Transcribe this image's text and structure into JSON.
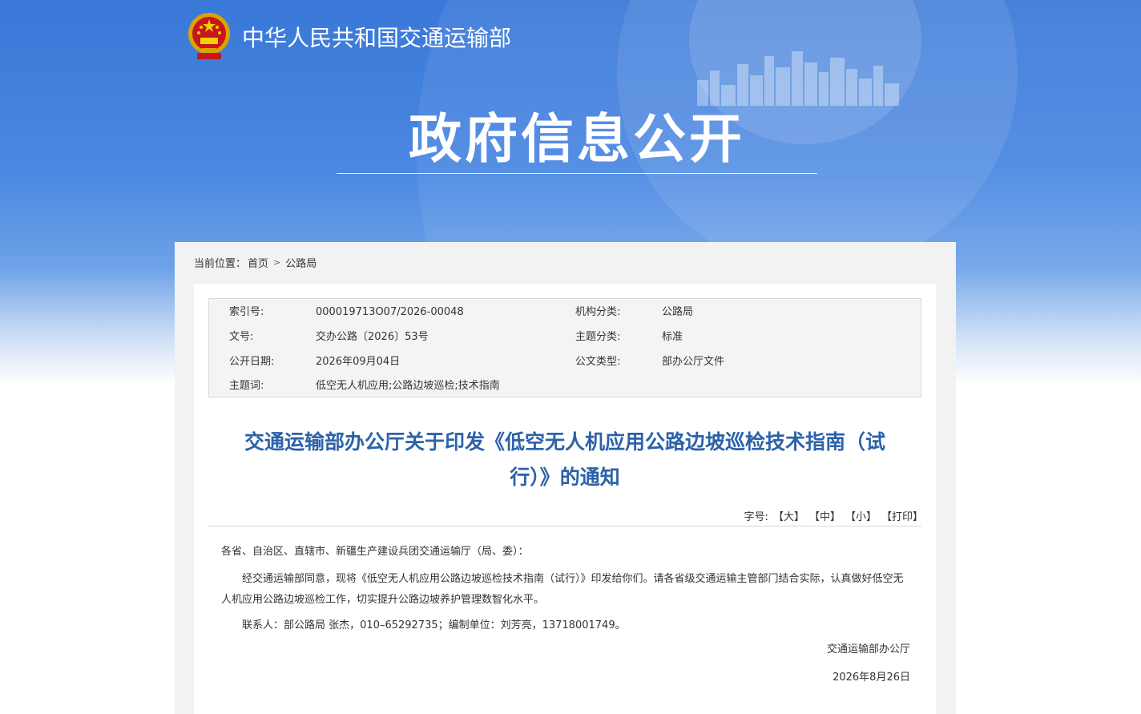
{
  "header": {
    "ministry_name": "中华人民共和国交通运输部",
    "section_title": "政府信息公开"
  },
  "breadcrumb": {
    "label": "当前位置：",
    "items": [
      "首页",
      "公路局"
    ],
    "separator": ">"
  },
  "meta": {
    "index_label": "索引号:",
    "index_value": "000019713O07/2026-00048",
    "org_label": "机构分类:",
    "org_value": "公路局",
    "doc_no_label": "文号:",
    "doc_no_value": "交办公路〔2026〕53号",
    "topic_label": "主题分类:",
    "topic_value": "标准",
    "date_label": "公开日期:",
    "date_value": "2026年09月04日",
    "type_label": "公文类型:",
    "type_value": "部办公厅文件",
    "keywords_label": "主题词:",
    "keywords_value": "低空无人机应用;公路边坡巡检;技术指南"
  },
  "document": {
    "title_line1": "交通运输部办公厅关于印发《低空无人机应用公路边坡巡检技术指南（试",
    "title_line2": "行）》的通知",
    "font_size_label": "字号:",
    "font_large": "【大】",
    "font_medium": "【中】",
    "font_small": "【小】",
    "print": "【打印】",
    "salutation": "各省、自治区、直辖市、新疆生产建设兵团交通运输厅（局、委）：",
    "paragraph1": "经交通运输部同意，现将《低空无人机应用公路边坡巡检技术指南（试行）》印发给你们。请各省级交通运输主管部门结合实际，认真做好低空无人机应用公路边坡巡检工作，切实提升公路边坡养护管理数智化水平。",
    "contact": "联系人：部公路局 张杰，010–65292735；编制单位：刘芳亮，13718001749。",
    "signature": "交通运输部办公厅",
    "sign_date": "2026年8月26日"
  },
  "colors": {
    "hero_blue": "#3a78d8",
    "title_blue": "#2c62a9"
  }
}
